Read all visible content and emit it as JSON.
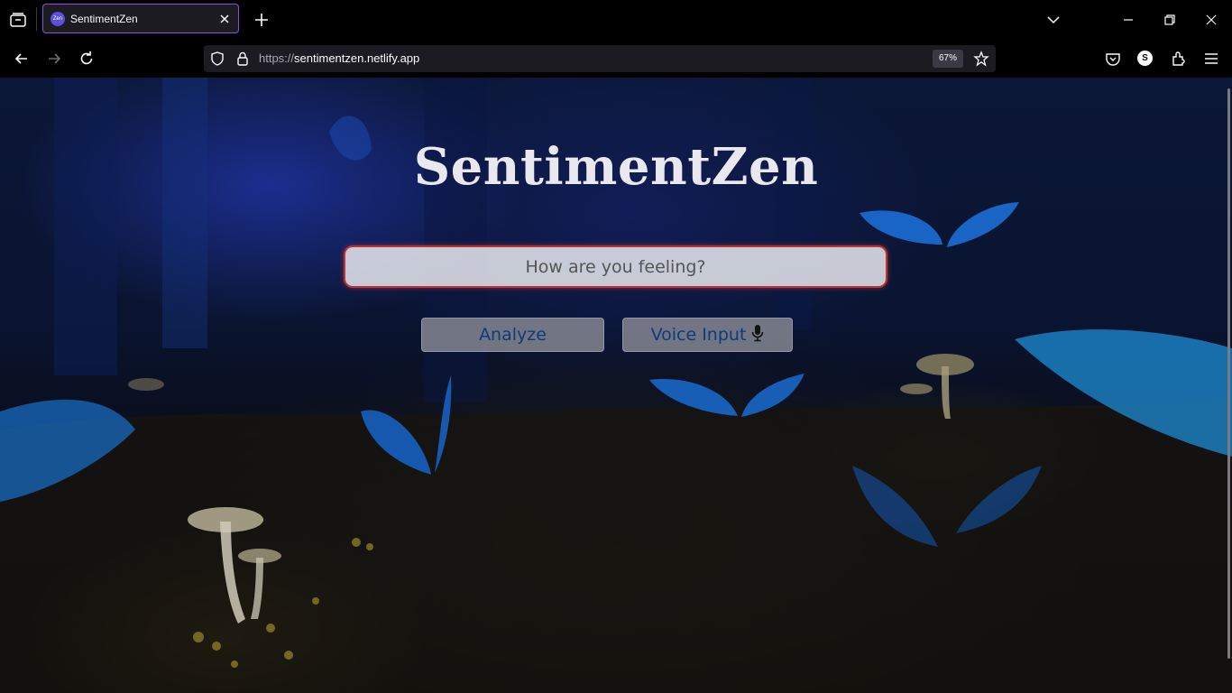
{
  "browser": {
    "tab": {
      "title": "SentimentZen",
      "favicon_text": "Zen"
    },
    "url": {
      "scheme": "https://",
      "host": "sentimentzen.netlify.app"
    },
    "zoom": "67%",
    "profile_initial": "S"
  },
  "page": {
    "title": "SentimentZen",
    "input_placeholder": "How are you feeling?",
    "analyze_label": "Analyze",
    "voice_label": "Voice Input"
  },
  "colors": {
    "accent_button_text": "#0f3b7a",
    "input_border": "#b33333",
    "tab_border": "#8a4fe0"
  }
}
